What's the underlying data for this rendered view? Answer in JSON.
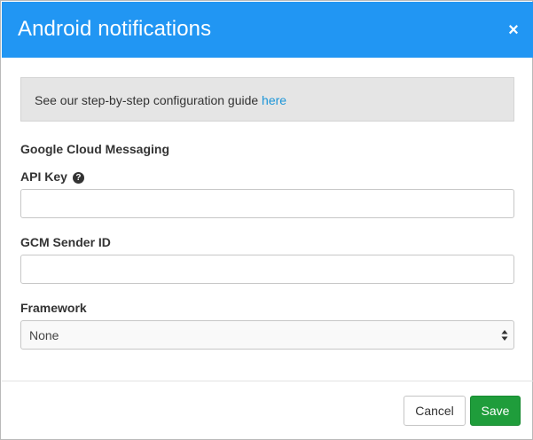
{
  "modal": {
    "title": "Android notifications",
    "close_symbol": "×"
  },
  "guide": {
    "text": "See our step-by-step configuration guide ",
    "link_label": "here"
  },
  "section": {
    "title": "Google Cloud Messaging"
  },
  "fields": {
    "api_key": {
      "label": "API Key",
      "value": "",
      "help_icon": "question-circle-icon"
    },
    "gcm_sender_id": {
      "label": "GCM Sender ID",
      "value": ""
    },
    "framework": {
      "label": "Framework",
      "selected": "None"
    }
  },
  "footer": {
    "cancel_label": "Cancel",
    "save_label": "Save"
  },
  "colors": {
    "header": "#2196f3",
    "link": "#1b95d8",
    "save_button": "#1f9d3b"
  }
}
